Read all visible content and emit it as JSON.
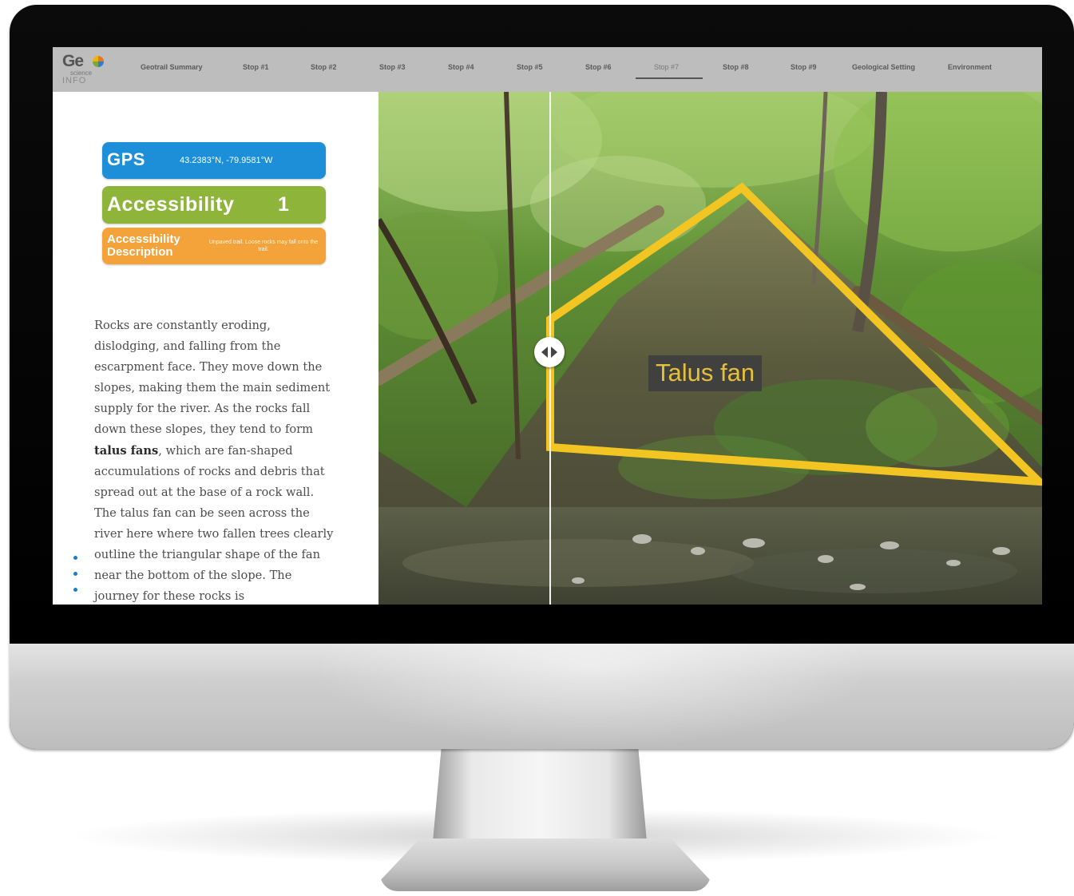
{
  "logo": {
    "geo": "Ge",
    "science": "science",
    "info": "INFO"
  },
  "nav": {
    "items": [
      {
        "label": "Geotrail Summary"
      },
      {
        "label": "Stop #1"
      },
      {
        "label": "Stop #2"
      },
      {
        "label": "Stop #3"
      },
      {
        "label": "Stop #4"
      },
      {
        "label": "Stop #5"
      },
      {
        "label": "Stop #6"
      },
      {
        "label": "Stop #7"
      },
      {
        "label": "Stop #8"
      },
      {
        "label": "Stop #9"
      },
      {
        "label": "Geological Setting"
      },
      {
        "label": "Environment"
      }
    ],
    "active": "Stop #7"
  },
  "info": {
    "gps_label": "GPS",
    "gps_value": "43.2383°N, -79.9581°W",
    "accessibility_label": "Accessibility",
    "accessibility_value": "1",
    "accessibility_description_label": "Accessibility Description",
    "accessibility_description_value": "Unpaved trail. Loose rocks may fall onto the trail."
  },
  "body": {
    "p1": "Rocks are constantly eroding, dislodging, and falling from the escarpment face. They move down the slopes, making them the main sediment supply for the river. As the rocks fall down these slopes, they tend to form ",
    "bold": "talus fans",
    "p2": ", which are fan-shaped accumulations of rocks and debris that spread out at the base of a rock wall. The talus fan can be seen across the river here where two fallen trees clearly outline the triangular shape of the fan near the bottom of the slope. The journey for these rocks is"
  },
  "photo": {
    "annotation": "Talus fan"
  },
  "colors": {
    "gps": "#1d8fd8",
    "accessibility": "#8eb53a",
    "accessibility_description": "#f4a23a",
    "outline": "#f2c523",
    "nav_bar": "#bdbdbd"
  },
  "icons": [
    "slider-left-arrow-icon",
    "slider-right-arrow-icon",
    "globe-logo-icon"
  ]
}
